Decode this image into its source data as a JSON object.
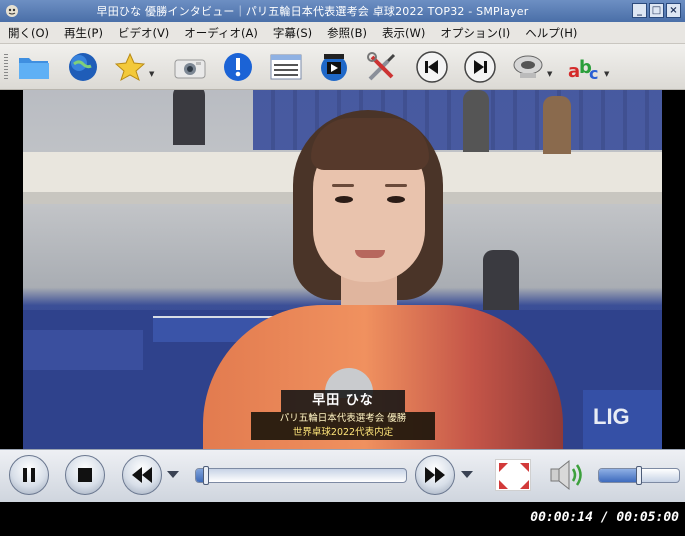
{
  "window": {
    "title": "早田ひな 優勝インタビュー｜パリ五輪日本代表選考会 卓球2022 TOP32 - SMPlayer",
    "buttons": {
      "minimize": "_",
      "maximize": "□",
      "close": "×"
    }
  },
  "menu": [
    {
      "label": "開く(O)"
    },
    {
      "label": "再生(P)"
    },
    {
      "label": "ビデオ(V)"
    },
    {
      "label": "オーディオ(A)"
    },
    {
      "label": "字幕(S)"
    },
    {
      "label": "参照(B)"
    },
    {
      "label": "表示(W)"
    },
    {
      "label": "オプション(I)"
    },
    {
      "label": "ヘルプ(H)"
    }
  ],
  "toolbar": {
    "buttons": [
      {
        "icon": "folder-icon"
      },
      {
        "icon": "globe-icon"
      },
      {
        "icon": "star-icon",
        "dropdown": true
      },
      {
        "icon": "camera-icon"
      },
      {
        "icon": "info-icon"
      },
      {
        "icon": "playlist-icon"
      },
      {
        "icon": "video-settings-icon"
      },
      {
        "icon": "preferences-icon"
      },
      {
        "icon": "previous-icon"
      },
      {
        "icon": "next-icon"
      },
      {
        "icon": "audio-menu-icon",
        "dropdown": true
      },
      {
        "icon": "subtitles-menu-icon",
        "dropdown": true
      }
    ]
  },
  "video": {
    "caption": {
      "name": "早田 ひな",
      "line1": "パリ五輪日本代表選考会 優勝",
      "line2": "世界卓球2022代表内定"
    },
    "board_text": "LIG"
  },
  "controls": {
    "seek_progress": 0.047,
    "volume_level": 0.5
  },
  "status": {
    "time": "00:00:14 / 00:05:00"
  }
}
